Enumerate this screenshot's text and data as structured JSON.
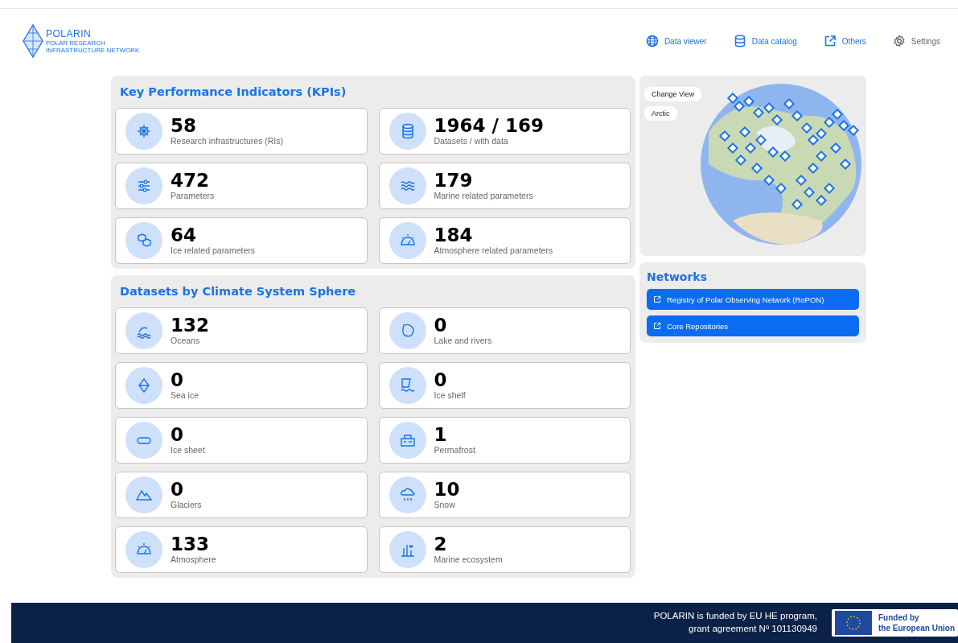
{
  "header": {
    "logo": {
      "name": "POLARIN",
      "subtitle": "POLAR RESEARCH INFRASTRUCTURE NETWORK"
    },
    "nav": [
      {
        "label": "Data viewer",
        "kind": "link"
      },
      {
        "label": "Data catalog",
        "kind": "link"
      },
      {
        "label": "Others",
        "kind": "link"
      },
      {
        "label": "Settings",
        "kind": "menu"
      }
    ]
  },
  "kpis": {
    "title": "Key Performance Indicators (KPIs)",
    "cards": [
      {
        "value": "58",
        "label": "Research infrastructures (RIs)"
      },
      {
        "value": "1964 / 169",
        "label": "Datasets / with data"
      },
      {
        "value": "472",
        "label": "Parameters"
      },
      {
        "value": "179",
        "label": "Marine related parameters"
      },
      {
        "value": "64",
        "label": "Ice related parameters"
      },
      {
        "value": "184",
        "label": "Atmosphere related parameters"
      }
    ]
  },
  "spheres": {
    "title": "Datasets by Climate System Sphere",
    "cards": [
      {
        "value": "132",
        "label": "Oceans"
      },
      {
        "value": "0",
        "label": "Lake and rivers"
      },
      {
        "value": "0",
        "label": "Sea ice"
      },
      {
        "value": "0",
        "label": "Ice shelf"
      },
      {
        "value": "0",
        "label": "Ice sheet"
      },
      {
        "value": "1",
        "label": "Permafrost"
      },
      {
        "value": "0",
        "label": "Glaciers"
      },
      {
        "value": "10",
        "label": "Snow"
      },
      {
        "value": "133",
        "label": "Atmosphere"
      },
      {
        "value": "2",
        "label": "Marine ecosystem"
      }
    ]
  },
  "map": {
    "buttons": [
      "Change View",
      "Arctic"
    ]
  },
  "networks": {
    "title": "Networks",
    "links": [
      "Registry of Polar Observing Network (RoPON)",
      "Core Repositories"
    ]
  },
  "footer": {
    "lines": [
      "POLARIN is funded by EU HE program,",
      "grant agreement Nº 101130949"
    ],
    "eu_lines": [
      "Funded by",
      "the European Union"
    ]
  }
}
